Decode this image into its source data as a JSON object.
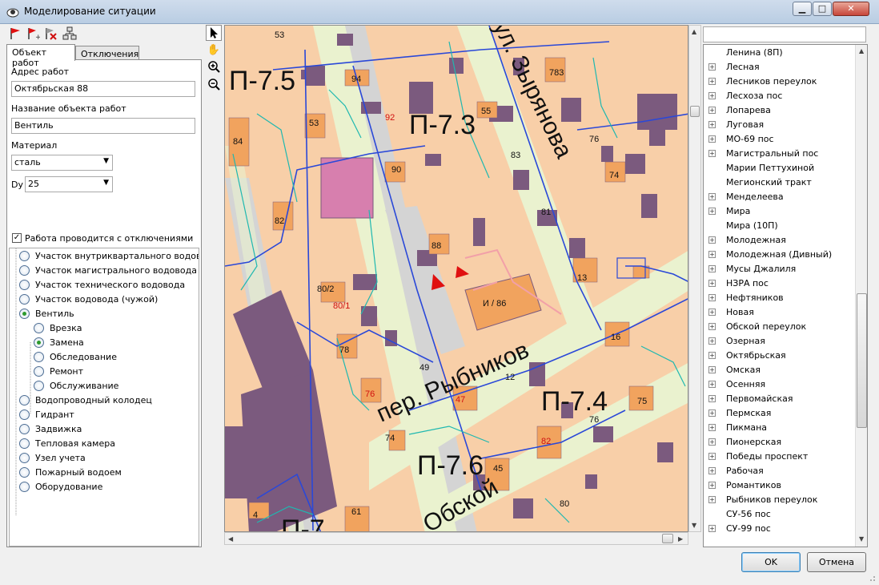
{
  "window": {
    "title": "Моделирование ситуации",
    "controls": {
      "minimize": "▁",
      "maximize": "□",
      "close": "✕"
    }
  },
  "tabs": [
    {
      "label": "Объект работ",
      "active": true
    },
    {
      "label": "Отключения",
      "active": false
    }
  ],
  "form": {
    "address_label": "Адрес работ",
    "address_value": "Октябрьская 88",
    "object_name_label": "Название объекта работ",
    "object_name_value": "Вентиль",
    "material_label": "Материал",
    "material_value": "сталь",
    "dy_label": "Dy",
    "dy_value": "25",
    "shutdown_checkbox_label": "Работа проводится с отключениями",
    "shutdown_checked": true
  },
  "object_tree": [
    {
      "label": "Участок внутриквартального водов",
      "level": 0,
      "selected": false
    },
    {
      "label": "Участок магистрального водовода",
      "level": 0,
      "selected": false
    },
    {
      "label": "Участок технического водовода",
      "level": 0,
      "selected": false
    },
    {
      "label": "Участок водовода (чужой)",
      "level": 0,
      "selected": false
    },
    {
      "label": "Вентиль",
      "level": 0,
      "selected": true
    },
    {
      "label": "Врезка",
      "level": 1,
      "selected": false
    },
    {
      "label": "Замена",
      "level": 1,
      "selected": true
    },
    {
      "label": "Обследование",
      "level": 1,
      "selected": false
    },
    {
      "label": "Ремонт",
      "level": 1,
      "selected": false
    },
    {
      "label": "Обслуживание",
      "level": 1,
      "selected": false
    },
    {
      "label": "Водопроводный колодец",
      "level": 0,
      "selected": false
    },
    {
      "label": "Гидрант",
      "level": 0,
      "selected": false
    },
    {
      "label": "Задвижка",
      "level": 0,
      "selected": false
    },
    {
      "label": "Тепловая камера",
      "level": 0,
      "selected": false
    },
    {
      "label": "Узел учета",
      "level": 0,
      "selected": false
    },
    {
      "label": "Пожарный водоем",
      "level": 0,
      "selected": false
    },
    {
      "label": "Оборудование",
      "level": 0,
      "selected": false
    }
  ],
  "map": {
    "zones": [
      "П-7.5",
      "П-7.3",
      "П-7.4",
      "П-7.6",
      "П-7"
    ],
    "streets": [
      "ул. Зырянова",
      "пер. Рыбников",
      "Обской"
    ],
    "house_numbers": [
      "53",
      "94",
      "92",
      "55",
      "783",
      "84",
      "53",
      "90",
      "83",
      "76",
      "74",
      "82",
      "81",
      "88",
      "80/2",
      "80/1",
      "И / 86",
      "13",
      "78",
      "16",
      "49",
      "12",
      "76",
      "47",
      "75",
      "76",
      "74",
      "82",
      "45",
      "61",
      "4",
      "80"
    ]
  },
  "streets_list": [
    {
      "label": "Ленина (8П)",
      "expandable": false
    },
    {
      "label": "Лесная",
      "expandable": true
    },
    {
      "label": "Лесников переулок",
      "expandable": true
    },
    {
      "label": "Лесхоза пос",
      "expandable": true
    },
    {
      "label": "Лопарева",
      "expandable": true
    },
    {
      "label": "Луговая",
      "expandable": true
    },
    {
      "label": "МО-69 пос",
      "expandable": true
    },
    {
      "label": "Магистральный пос",
      "expandable": true
    },
    {
      "label": "Марии Петтухиной",
      "expandable": false
    },
    {
      "label": "Мегионский тракт",
      "expandable": false
    },
    {
      "label": "Менделеева",
      "expandable": true
    },
    {
      "label": "Мира",
      "expandable": true
    },
    {
      "label": "Мира (10П)",
      "expandable": false
    },
    {
      "label": "Молодежная",
      "expandable": true
    },
    {
      "label": "Молодежная (Дивный)",
      "expandable": true
    },
    {
      "label": "Мусы Джалиля",
      "expandable": true
    },
    {
      "label": "НЗРА пос",
      "expandable": true
    },
    {
      "label": "Нефтяников",
      "expandable": true
    },
    {
      "label": "Новая",
      "expandable": true
    },
    {
      "label": "Обской переулок",
      "expandable": true
    },
    {
      "label": "Озерная",
      "expandable": true
    },
    {
      "label": "Октябрьская",
      "expandable": true
    },
    {
      "label": "Омская",
      "expandable": true
    },
    {
      "label": "Осенняя",
      "expandable": true
    },
    {
      "label": "Первомайская",
      "expandable": true
    },
    {
      "label": "Пермская",
      "expandable": true
    },
    {
      "label": "Пикмана",
      "expandable": true
    },
    {
      "label": "Пионерская",
      "expandable": true
    },
    {
      "label": "Победы проспект",
      "expandable": true
    },
    {
      "label": "Рабочая",
      "expandable": true
    },
    {
      "label": "Романтиков",
      "expandable": true
    },
    {
      "label": "Рыбников переулок",
      "expandable": true
    },
    {
      "label": "СУ-56 пос",
      "expandable": false
    },
    {
      "label": "СУ-99 пос",
      "expandable": true
    }
  ],
  "buttons": {
    "ok": "OK",
    "cancel": "Отмена"
  },
  "colors": {
    "block": "#f8cfa8",
    "building": "#7b5a7e",
    "house": "#f1a35e",
    "road_green": "#eaf2cf",
    "road_gray": "#cfcfcf",
    "pipe_blue": "#2a48d8",
    "pipe_cyan": "#1fb8b0"
  }
}
